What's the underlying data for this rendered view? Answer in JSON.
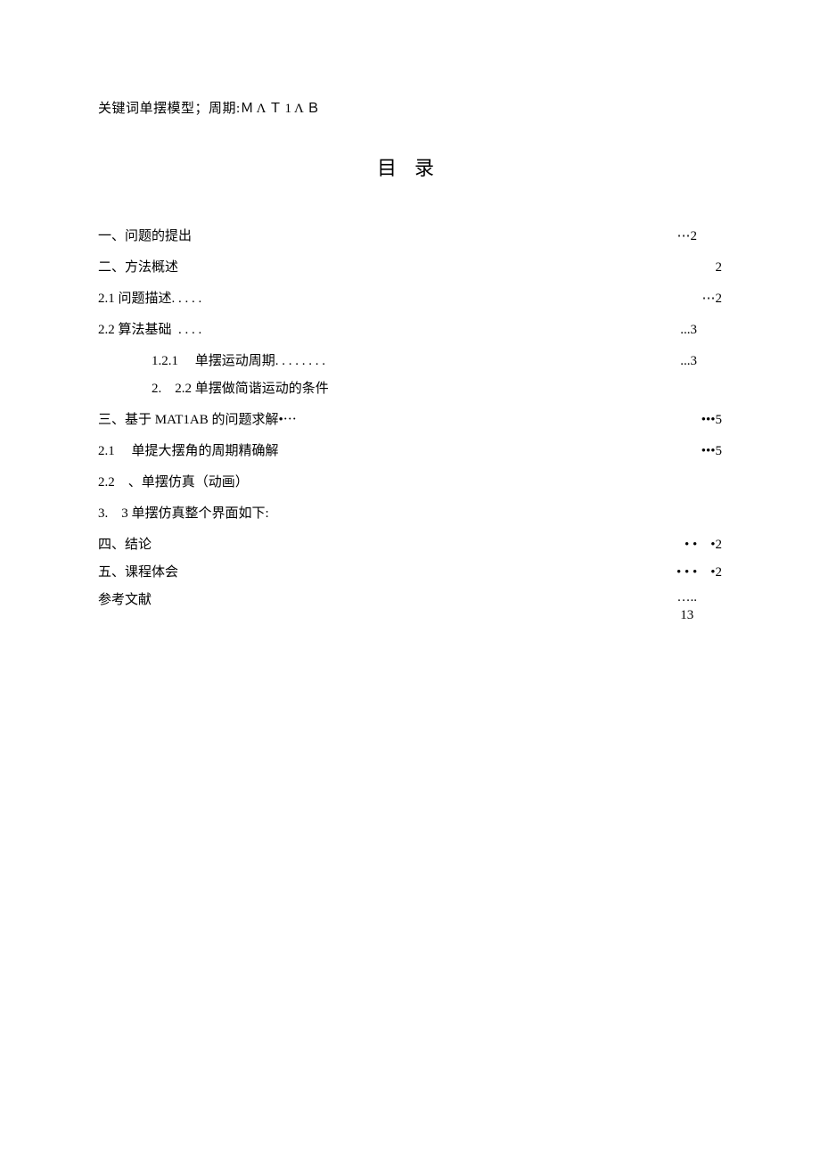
{
  "keywords": {
    "prefix": "关键词单摆模型；周期:",
    "term": "ＭΛＴ1ΛＢ"
  },
  "toc_title": "目录",
  "toc": {
    "r1": {
      "lead": "一、问题的提出",
      "tail": "⋯2"
    },
    "r2": {
      "lead": "二、方法概述",
      "tail": "2"
    },
    "r3": {
      "lead": "2.1 问题描述. . . . .",
      "tail": "⋯2"
    },
    "r4": {
      "lead": "2.2 算法基础  . . . .",
      "tail": "...3"
    },
    "r5": {
      "lead": "1.2.1     单摆运动周期. . . . . . . .",
      "tail": "...3"
    },
    "r6": {
      "lead": "2.    2.2 单摆做简谐运动的条件",
      "tail": ""
    },
    "r7": {
      "lead": "三、基于 MAT1AB 的问题求解•⋯",
      "tail": "•••5"
    },
    "r8": {
      "lead": "2.1     单提大摆角的周期精确解",
      "tail": "•••5"
    },
    "r9": {
      "lead": "2.2    、单摆仿真（动画）",
      "tail": ""
    },
    "r10": {
      "lead": "3.    3 单摆仿真整个界面如下:",
      "tail": ""
    },
    "r11": {
      "lead": "四、结论",
      "tail": "• •    •2"
    },
    "r12": {
      "lead": "五、课程体会",
      "tail": "• • •    •2"
    },
    "r13": {
      "lead": "参考文献",
      "tail_top": "…..",
      "tail_bottom": "13"
    }
  }
}
